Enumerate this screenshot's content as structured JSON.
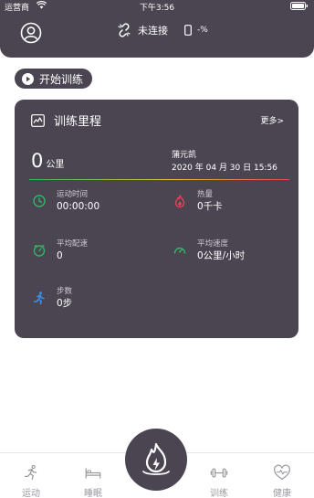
{
  "status_bar": {
    "carrier": "运营商",
    "time": "下午3:56"
  },
  "header": {
    "connection_text": "未连接",
    "battery_text": "-%"
  },
  "start_training": {
    "label": "开始训练"
  },
  "mileage_card": {
    "title": "训练里程",
    "more": "更多>",
    "distance_value": "0",
    "distance_unit": "公里",
    "user_name": "蒲元凯",
    "datetime": "2020 年 04 月 30 日 15:56",
    "stats": [
      {
        "label": "运动时间",
        "value": "00:00:00",
        "icon": "clock-icon",
        "color": "#2fb567"
      },
      {
        "label": "热量",
        "value": "0千卡",
        "icon": "flame-icon",
        "color": "#e7435a"
      },
      {
        "label": "平均配速",
        "value": "0",
        "icon": "pace-icon",
        "color": "#2fb567"
      },
      {
        "label": "平均速度",
        "value": "0公里/小时",
        "icon": "speedometer-icon",
        "color": "#2fb567"
      },
      {
        "label": "步数",
        "value": "0步",
        "icon": "runner-icon",
        "color": "#3a8ee6"
      }
    ]
  },
  "tabbar": {
    "tabs": [
      {
        "label": "运动",
        "icon": "running-icon"
      },
      {
        "label": "睡眠",
        "icon": "bed-icon"
      },
      {
        "label": "训练",
        "icon": "dumbbell-icon"
      },
      {
        "label": "健康",
        "icon": "heart-icon"
      }
    ],
    "center_icon": "flame-icon"
  },
  "colors": {
    "primary_dark": "#4b4552",
    "accent_green": "#2fb567",
    "accent_red": "#e7435a",
    "accent_blue": "#3a8ee6",
    "tab_gray": "#9b99a0"
  }
}
